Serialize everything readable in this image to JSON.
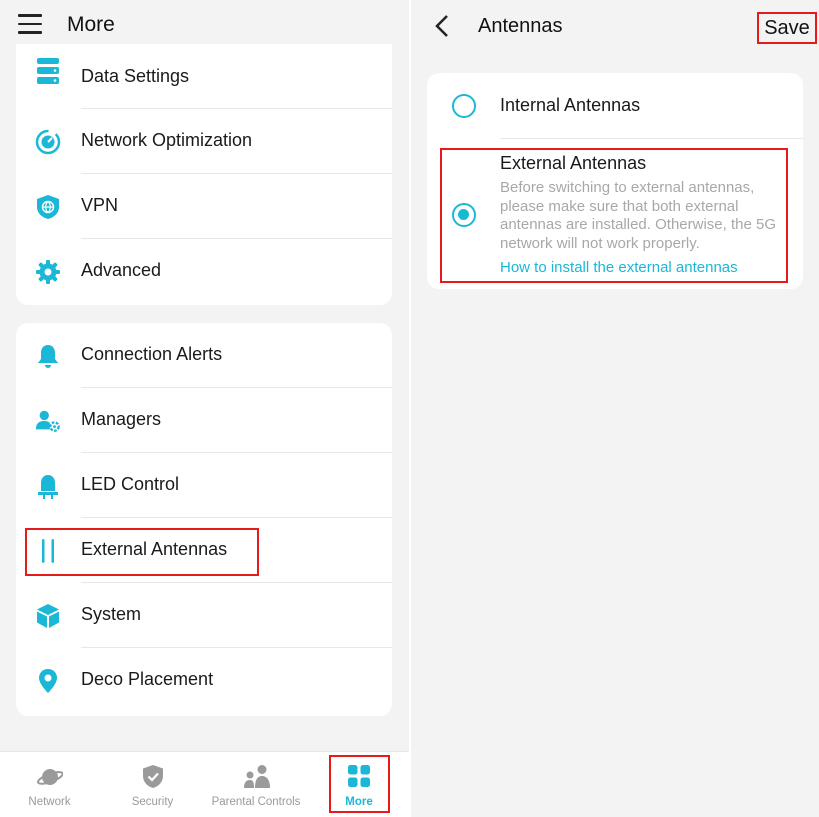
{
  "left_screen": {
    "title": "More",
    "group1": [
      {
        "label": "Data Settings",
        "icon": "database-icon"
      },
      {
        "label": "Network Optimization",
        "icon": "network-optimization-icon"
      },
      {
        "label": "VPN",
        "icon": "vpn-shield-icon"
      },
      {
        "label": "Advanced",
        "icon": "gear-icon"
      }
    ],
    "group2": [
      {
        "label": "Connection Alerts",
        "icon": "bell-icon"
      },
      {
        "label": "Managers",
        "icon": "managers-icon"
      },
      {
        "label": "LED Control",
        "icon": "led-icon"
      },
      {
        "label": "External Antennas",
        "icon": "antennas-icon"
      },
      {
        "label": "System",
        "icon": "cube-icon"
      },
      {
        "label": "Deco Placement",
        "icon": "location-pin-icon"
      }
    ],
    "bottom_nav": [
      {
        "label": "Network",
        "icon": "planet-icon",
        "active": false
      },
      {
        "label": "Security",
        "icon": "shield-check-icon",
        "active": false
      },
      {
        "label": "Parental Controls",
        "icon": "family-icon",
        "active": false
      },
      {
        "label": "More",
        "icon": "grid-icon",
        "active": true
      }
    ]
  },
  "right_screen": {
    "title": "Antennas",
    "save_label": "Save",
    "options": [
      {
        "label": "Internal Antennas",
        "selected": false
      },
      {
        "label": "External Antennas",
        "selected": true,
        "description": "Before switching to external antennas, please make sure that both external antennas are installed. Otherwise, the 5G network will not work properly.",
        "link": "How to install the external antennas"
      }
    ]
  },
  "colors": {
    "accent": "#1ab8d6",
    "highlight": "#e31b1b",
    "background": "#f3f3f3"
  }
}
